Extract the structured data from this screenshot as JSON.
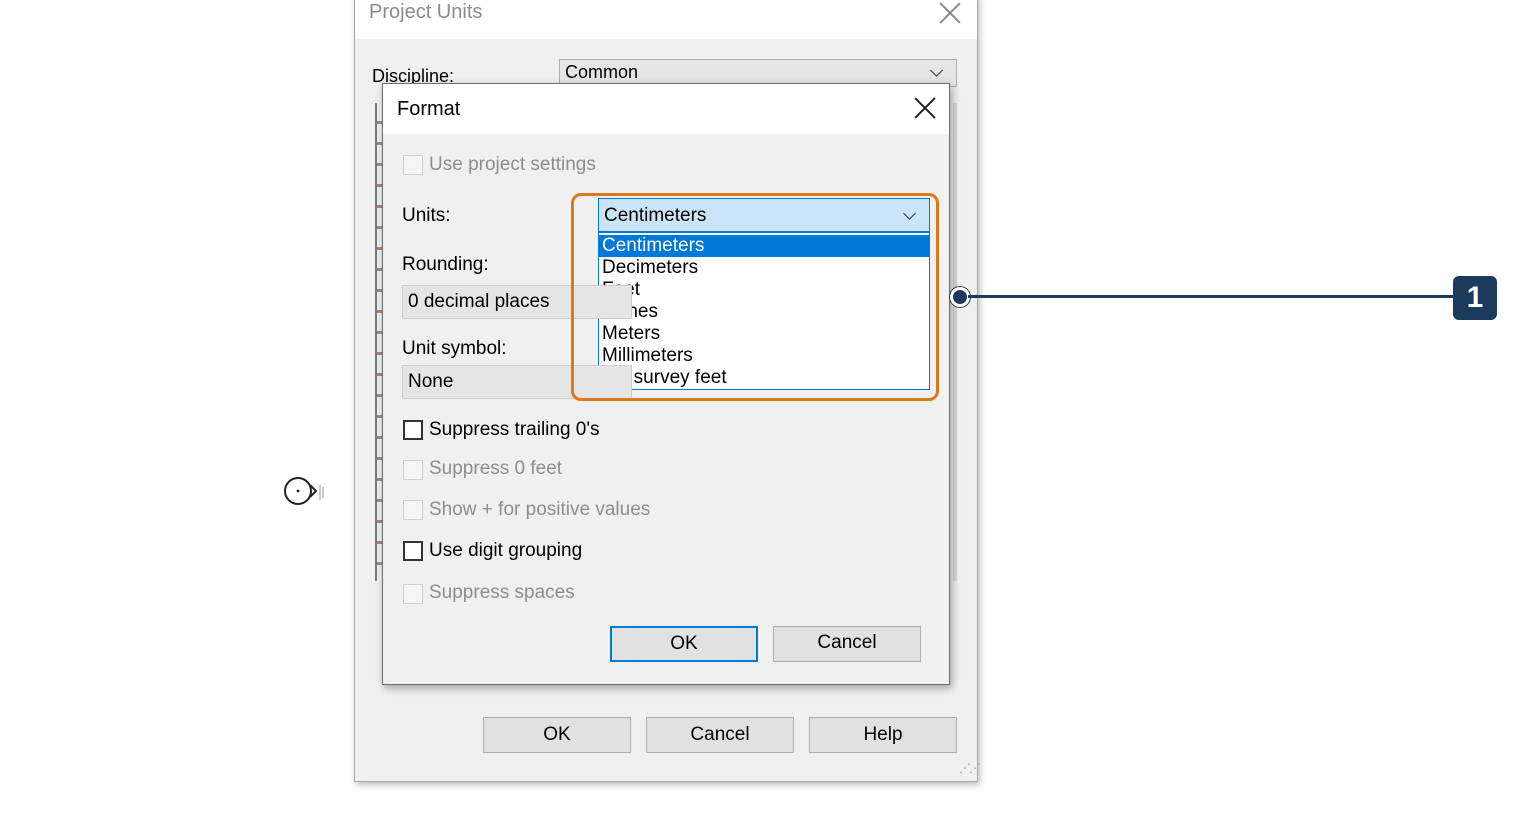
{
  "project_units": {
    "title": "Project Units",
    "discipline_label": "Discipline:",
    "discipline_value": "Common",
    "buttons": {
      "ok": "OK",
      "cancel": "Cancel",
      "help": "Help"
    }
  },
  "format_dialog": {
    "title": "Format",
    "use_project_settings": {
      "label": "Use project settings",
      "checked": false,
      "enabled": false
    },
    "units_label": "Units:",
    "units_selected": "Centimeters",
    "units_options": [
      "Centimeters",
      "Decimeters",
      "Feet",
      "Inches",
      "Meters",
      "Millimeters",
      "US survey feet"
    ],
    "rounding_label": "Rounding:",
    "rounding_value": "0 decimal places",
    "unit_symbol_label": "Unit symbol:",
    "unit_symbol_value": "None",
    "options": [
      {
        "label": "Suppress trailing 0's",
        "checked": false,
        "enabled": true
      },
      {
        "label": "Suppress 0 feet",
        "checked": false,
        "enabled": false
      },
      {
        "label": "Show + for positive values",
        "checked": false,
        "enabled": false
      },
      {
        "label": "Use digit grouping",
        "checked": false,
        "enabled": true
      },
      {
        "label": "Suppress spaces",
        "checked": false,
        "enabled": false
      }
    ],
    "buttons": {
      "ok": "OK",
      "cancel": "Cancel"
    }
  },
  "callout": {
    "number": "1",
    "highlight_color": "#d97a1e",
    "badge_color": "#1b3a5c"
  },
  "colors": {
    "accent": "#0078d7",
    "selection_bg": "#cce4f7"
  }
}
